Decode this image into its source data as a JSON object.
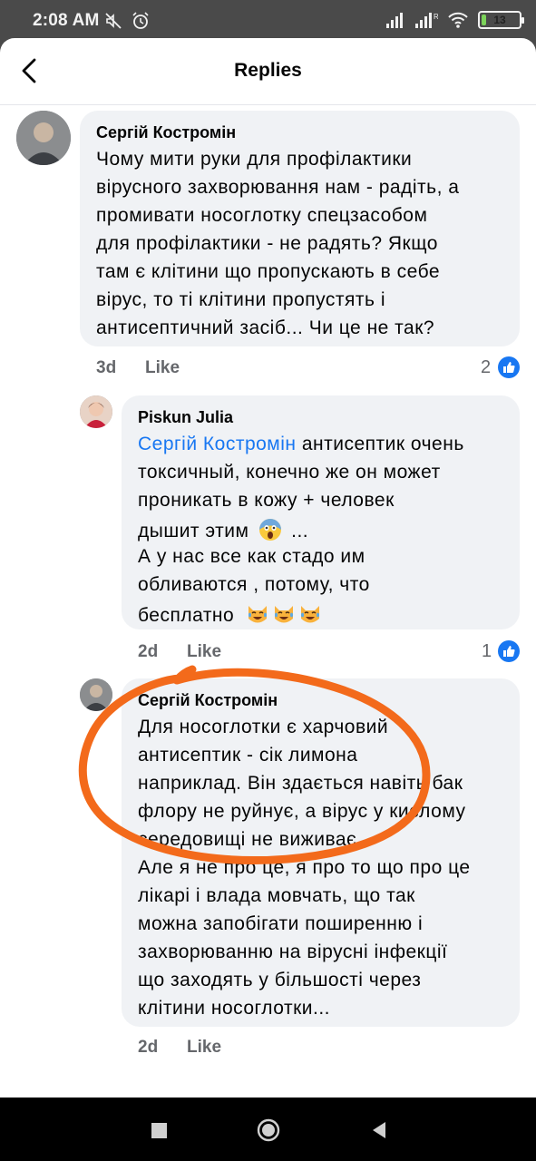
{
  "status_bar": {
    "time": "2:08 AM",
    "battery_level": "13",
    "battery_fraction": 0.13,
    "icons": [
      "mute-icon",
      "alarm-icon",
      "signal-icon",
      "signal-r-icon",
      "wifi-icon",
      "battery-icon"
    ]
  },
  "header": {
    "title": "Replies",
    "back_icon": "back-arrow-icon"
  },
  "comments": [
    {
      "author": "Сергій Костромін",
      "lines": [
        "Чому мити руки для профілактики",
        "вірусного захворювання нам - радіть, а",
        "промивати носоглотку спецзасобом",
        "для профілактики - не радять? Якщо",
        "там є клітини що пропускають в себе",
        "вірус, то ті клітини пропустять і",
        "антисептичний засіб... Чи це не так?"
      ],
      "time": "3d",
      "like_label": "Like",
      "reaction_count": "2"
    },
    {
      "author": "Piskun Julia",
      "mention": "Сергій Костромін",
      "lines": [
        " антисептик очень",
        "токсичный, конечно же он может",
        "проникать в кожу + человек",
        "дышит этим",
        "...",
        "А у нас все как стадо им",
        "обливаются , потому, что",
        "бесплатно"
      ],
      "emoji_fear": "face-screaming-in-fear-emoji",
      "emoji_laugh": "crying-laughing-cat-emoji",
      "time": "2d",
      "like_label": "Like",
      "reaction_count": "1"
    },
    {
      "author": "Сергій Костромін",
      "lines": [
        "Для носоглотки є харчовий",
        "антисептик - сік лимона",
        "наприклад. Він здається навіть бак",
        "флору не руйнує, а вірус у кислому",
        "середовищі не виживає.",
        "Але я не про це, я про то що про це",
        "лікарі і влада мовчать, що так",
        "можна запобігати поширенню і",
        "захворюванню на вірусні інфекції",
        "що заходять у більшості через",
        "клітини носоглотки..."
      ],
      "time": "2d",
      "like_label": "Like"
    }
  ],
  "annotation": {
    "color": "#f36a1b",
    "shape": "hand-drawn-circle"
  },
  "colors": {
    "accent": "#1877f2",
    "bubble": "#f0f2f5",
    "meta": "#65676b"
  },
  "nav_bar": {
    "icons": [
      "recents-square-icon",
      "home-circle-icon",
      "back-triangle-icon"
    ]
  }
}
